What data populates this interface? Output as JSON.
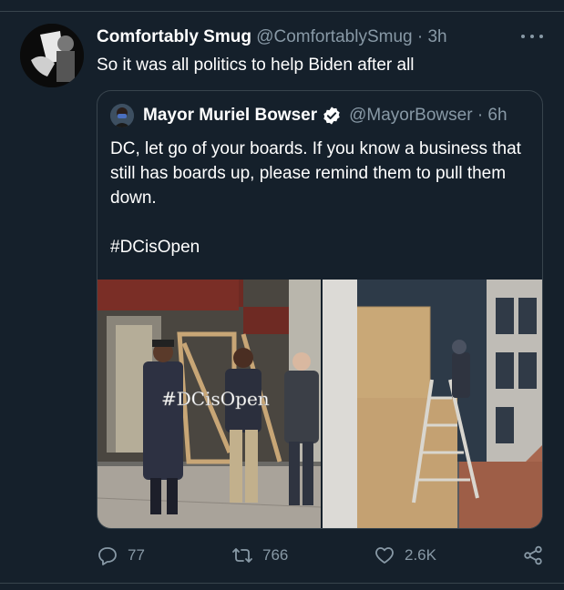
{
  "tweet": {
    "author_name": "Comfortably Smug",
    "author_handle": "@ComfortablySmug",
    "separator": "·",
    "time": "3h",
    "text": "So it was all politics to help Biden after all"
  },
  "quote": {
    "author_name": "Mayor Muriel Bowser",
    "author_handle": "@MayorBowser · 6h",
    "verified": true,
    "lines": [
      "DC, let go of your boards. If you know a business that still has boards up, please remind them to pull them down."
    ],
    "hashtag": "#DCisOpen",
    "photo_sign_text": "#DCisOpen"
  },
  "actions": {
    "replies": "77",
    "retweets": "766",
    "likes": "2.6K"
  },
  "colors": {
    "background": "#15202b",
    "secondary_text": "#8899a6",
    "border": "#38444d",
    "verified_blue": "#ffffff"
  }
}
